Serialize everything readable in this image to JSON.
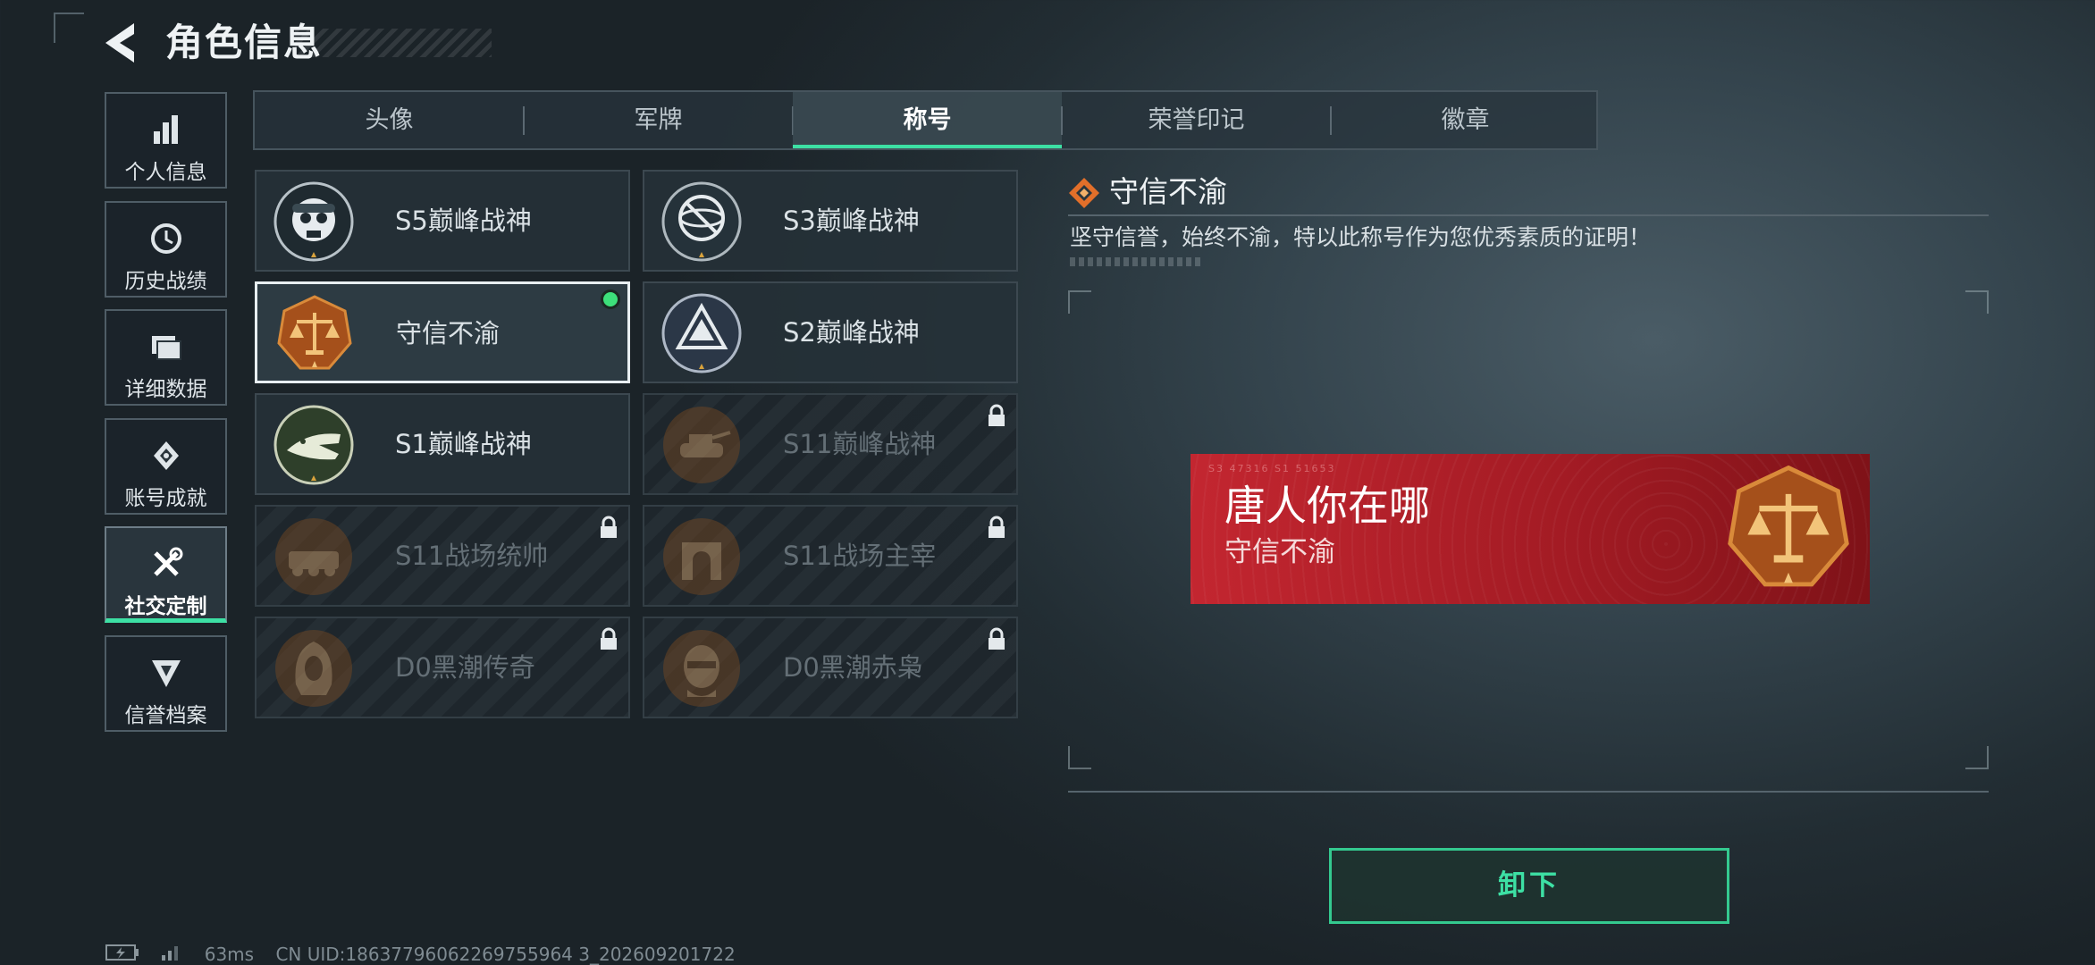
{
  "header": {
    "title": "角色信息",
    "back_icon": "chevron-left-icon"
  },
  "sidebar": {
    "items": [
      {
        "label": "个人信息",
        "icon": "bar-chart-icon",
        "active": false
      },
      {
        "label": "历史战绩",
        "icon": "history-clock-icon",
        "active": false
      },
      {
        "label": "详细数据",
        "icon": "folder-icon",
        "active": false
      },
      {
        "label": "账号成就",
        "icon": "achievement-badge-icon",
        "active": false
      },
      {
        "label": "社交定制",
        "icon": "tools-icon",
        "active": true
      },
      {
        "label": "信誉档案",
        "icon": "credit-emblem-icon",
        "active": false
      }
    ]
  },
  "tabs": [
    {
      "label": "头像",
      "active": false
    },
    {
      "label": "军牌",
      "active": false
    },
    {
      "label": "称号",
      "active": true
    },
    {
      "label": "荣誉印记",
      "active": false
    },
    {
      "label": "徽章",
      "active": false
    }
  ],
  "titles": [
    {
      "name": "S5巅峰战神",
      "icon": "skull-emblem-icon",
      "locked": false,
      "selected": false
    },
    {
      "name": "S3巅峰战神",
      "icon": "globe-emblem-icon",
      "locked": false,
      "selected": false
    },
    {
      "name": "守信不渝",
      "icon": "scales-emblem-icon",
      "locked": false,
      "selected": true
    },
    {
      "name": "S2巅峰战神",
      "icon": "pyramid-emblem-icon",
      "locked": false,
      "selected": false
    },
    {
      "name": "S1巅峰战神",
      "icon": "crocodile-emblem-icon",
      "locked": false,
      "selected": false
    },
    {
      "name": "S11巅峰战神",
      "icon": "tank-emblem-icon",
      "locked": true,
      "selected": false
    },
    {
      "name": "S11战场统帅",
      "icon": "armored-vehicle-emblem-icon",
      "locked": true,
      "selected": false
    },
    {
      "name": "S11战场主宰",
      "icon": "arch-emblem-icon",
      "locked": true,
      "selected": false
    },
    {
      "name": "D0黑潮传奇",
      "icon": "hooded-figure-emblem-icon",
      "locked": true,
      "selected": false
    },
    {
      "name": "D0黑潮赤枭",
      "icon": "masked-figure-emblem-icon",
      "locked": true,
      "selected": false
    }
  ],
  "detail": {
    "title": "守信不渝",
    "description": "坚守信誉，始终不渝，特以此称号作为您优秀素质的证明！",
    "banner": {
      "player_name": "唐人你在哪",
      "title": "守信不渝",
      "code": "S3 47316 S1 51653"
    },
    "unequip_label": "卸下"
  },
  "status": {
    "ping": "63ms",
    "uid": "CN UID:18637796062269755964 3_202609201722"
  },
  "colors": {
    "accent": "#3de0a4",
    "banner_red": "#b1212a",
    "emblem_bronze": "#b4611e"
  }
}
